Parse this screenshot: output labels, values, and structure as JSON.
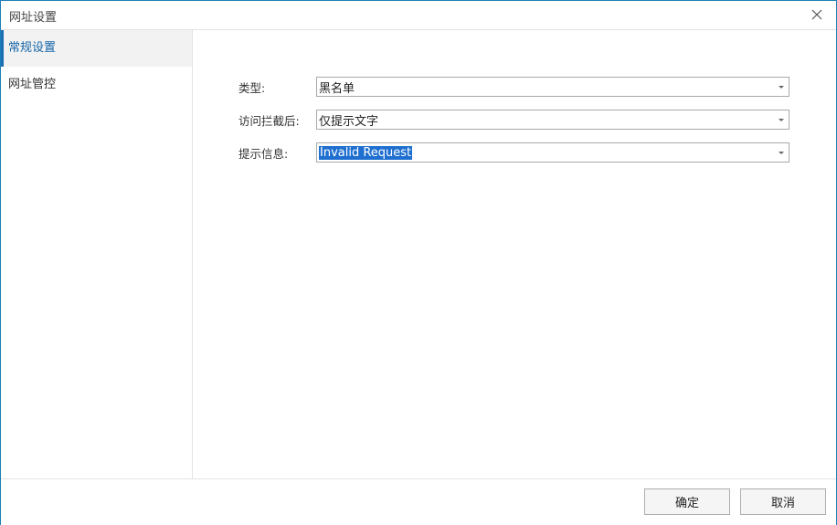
{
  "window": {
    "title": "网址设置"
  },
  "sidebar": {
    "items": [
      {
        "label": "常规设置",
        "active": true
      },
      {
        "label": "网址管控",
        "active": false
      }
    ]
  },
  "form": {
    "type": {
      "label": "类型:",
      "value": "黑名单"
    },
    "after_block": {
      "label": "访问拦截后:",
      "value": "仅提示文字"
    },
    "message": {
      "label": "提示信息:",
      "value": "Invalid Request"
    }
  },
  "footer": {
    "ok_label": "确定",
    "cancel_label": "取消"
  },
  "icons": {
    "close": "close-icon",
    "dropdown": "chevron-down-icon"
  },
  "colors": {
    "accent": "#1b6fb5",
    "active_text": "#1565a8",
    "selection": "#1e6fd0",
    "window_border": "#1b7fb7"
  }
}
